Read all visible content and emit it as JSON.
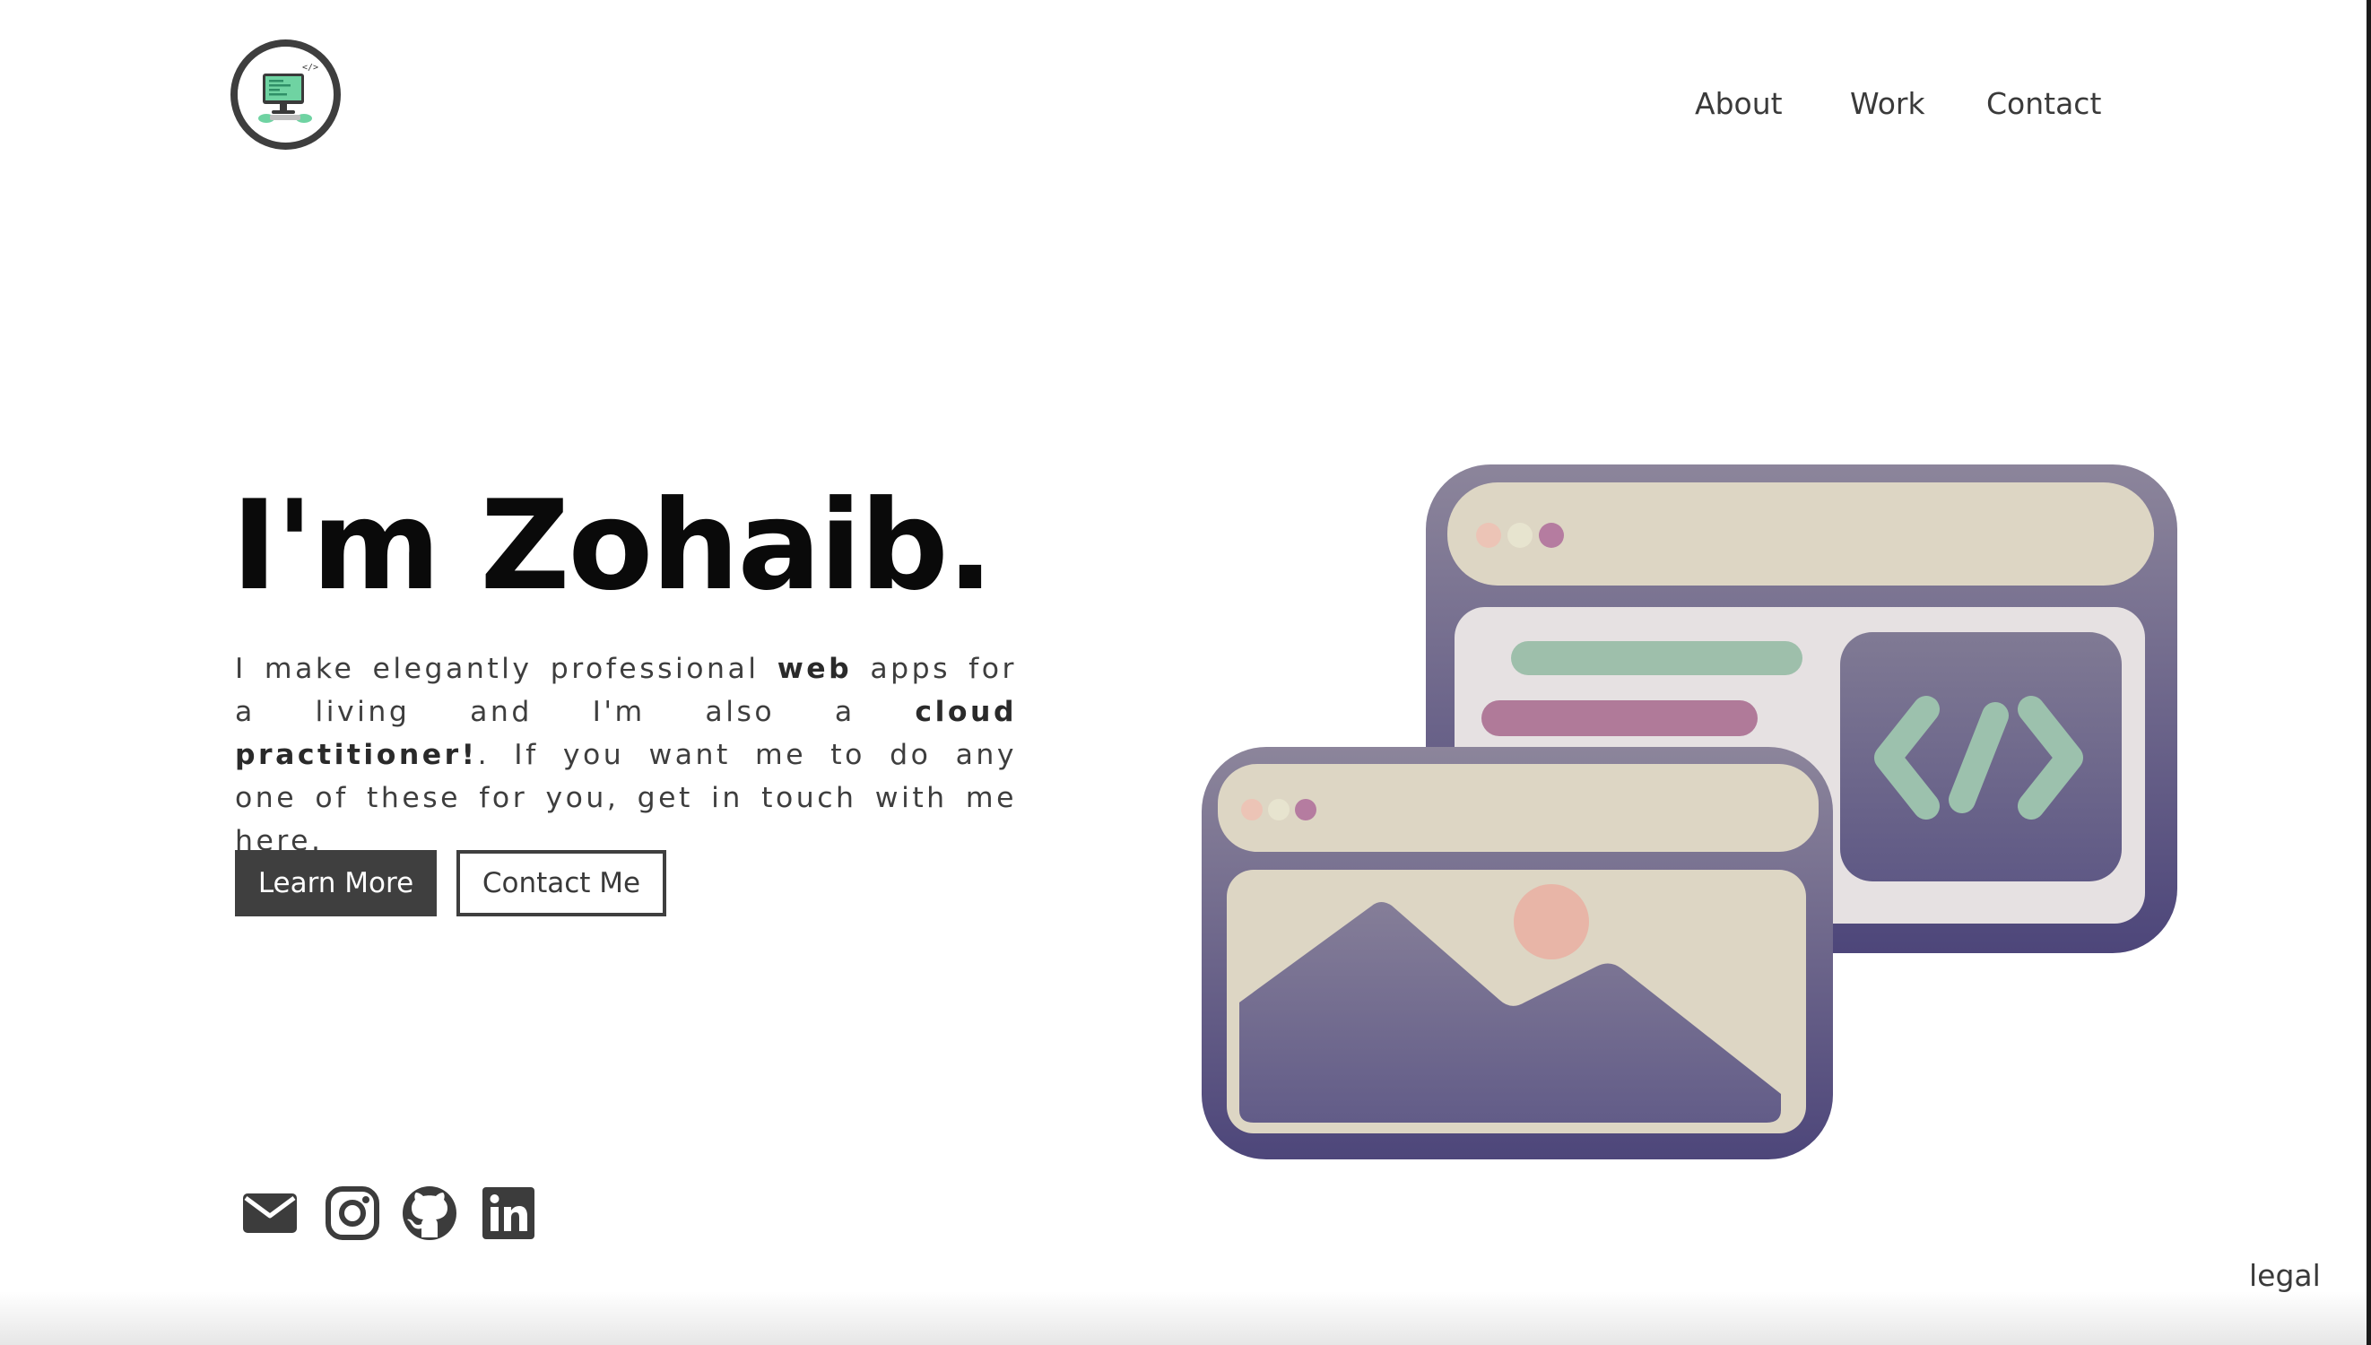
{
  "brand": {
    "logo_icon": "laptop-code-icon"
  },
  "nav": {
    "items": [
      {
        "label": "About"
      },
      {
        "label": "Work"
      },
      {
        "label": "Contact"
      }
    ]
  },
  "hero": {
    "title": "I'm Zohaib.",
    "intro": {
      "part1": "I make elegantly professional ",
      "bold1": "web",
      "part2": " apps for a living and I'm also a ",
      "bold2": "cloud practitioner!",
      "part3": ". If you want me to do any one of these for you, get in touch with me here."
    },
    "primary_button": "Learn More",
    "secondary_button": "Contact Me"
  },
  "socials": [
    {
      "icon": "mail-icon"
    },
    {
      "icon": "instagram-icon"
    },
    {
      "icon": "github-icon"
    },
    {
      "icon": "linkedin-icon"
    }
  ],
  "footer": {
    "legal": "legal"
  },
  "illustration": {
    "icon": "code-brackets-icon"
  },
  "colors": {
    "text_dark": "#0a0a0a",
    "text_body": "#3e3e3e",
    "button_dark": "#3f3f3f",
    "frame_purple": "#6a6485",
    "panel_beige": "#ddd6c4",
    "code_green": "#9cc1ad",
    "bar_pink": "#b07a99",
    "sun_peach": "#e8b5a7"
  }
}
